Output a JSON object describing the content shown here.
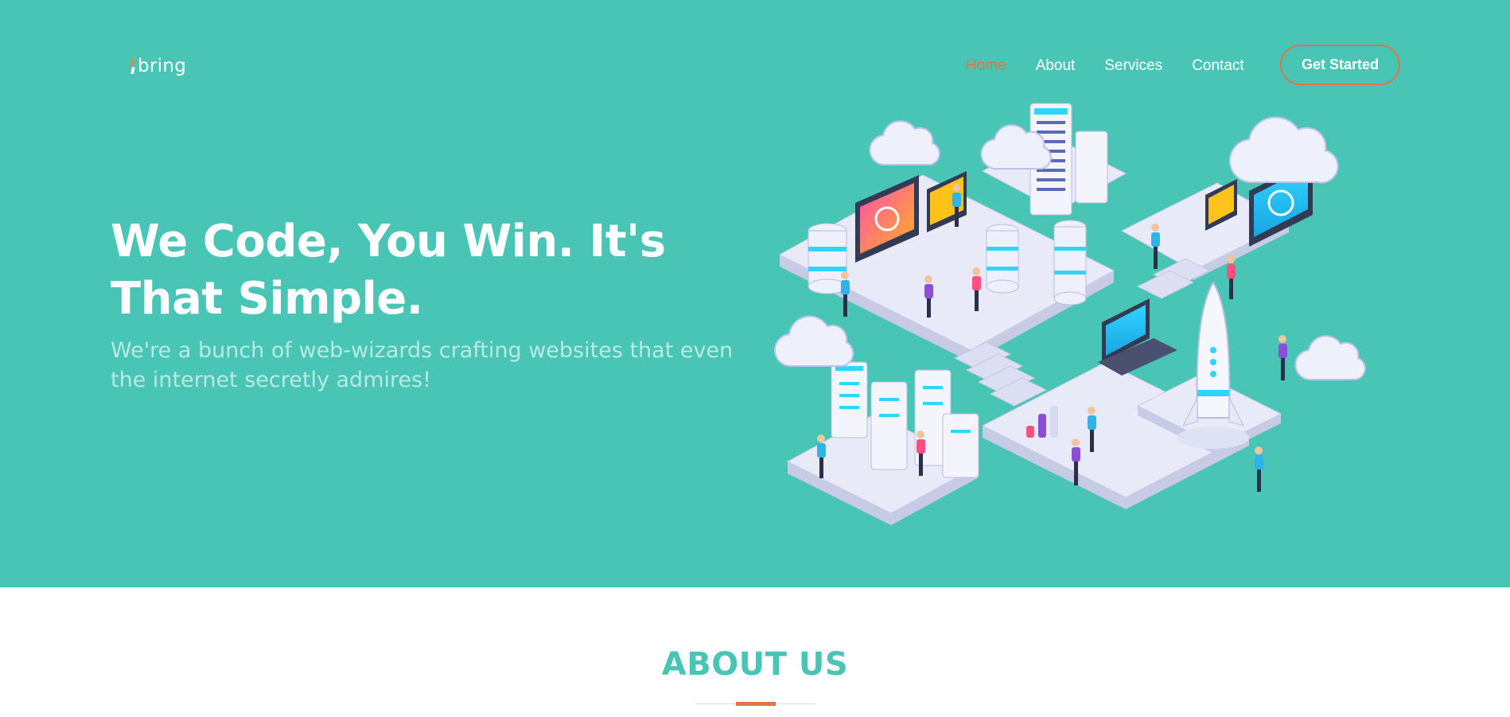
{
  "brand": {
    "name": "bring",
    "accent_color": "#e0754a",
    "primary_color": "#49c5b5"
  },
  "nav": {
    "items": [
      {
        "label": "Home",
        "active": true
      },
      {
        "label": "About",
        "active": false
      },
      {
        "label": "Services",
        "active": false
      },
      {
        "label": "Contact",
        "active": false
      }
    ],
    "cta_label": "Get Started"
  },
  "hero": {
    "title": "We Code, You Win. It's That Simple.",
    "subtitle": "We're a bunch of web-wizards crafting websites that even the internet secretly admires!",
    "illustration_icon": "isometric-tech-illustration-icon"
  },
  "about": {
    "title": "ABOUT US"
  }
}
